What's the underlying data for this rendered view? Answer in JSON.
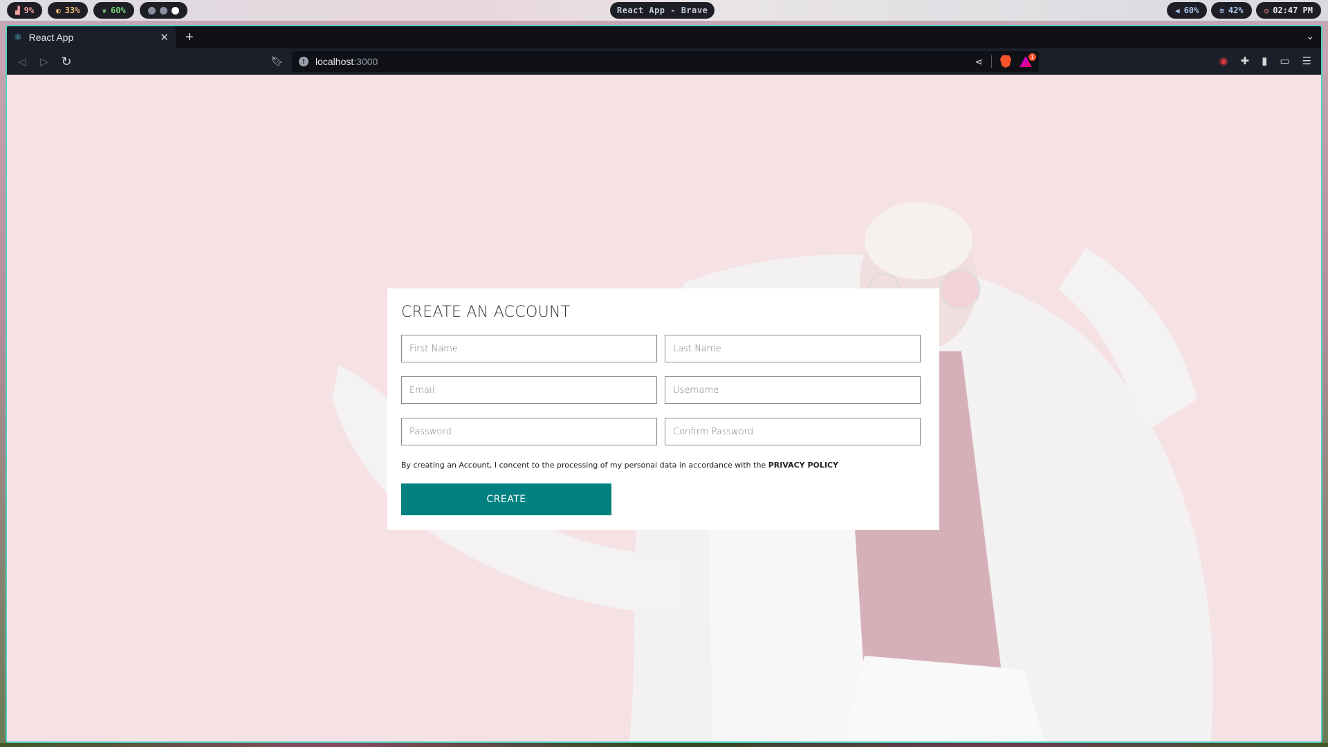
{
  "system_bar": {
    "cpu": "9%",
    "memory": "33%",
    "battery": "60%",
    "window_title": "React App - Brave",
    "volume": "60%",
    "wifi": "42%",
    "clock": "02:47 PM"
  },
  "browser": {
    "tab_title": "React App",
    "url_host": "localhost",
    "url_port": ":3000",
    "rewards_badge": "1"
  },
  "form": {
    "title": "CREATE AN ACCOUNT",
    "first_name_placeholder": "First Name",
    "last_name_placeholder": "Last Name",
    "email_placeholder": "Email",
    "username_placeholder": "Username",
    "password_placeholder": "Password",
    "confirm_password_placeholder": "Confirm Password",
    "agreement_text": "By creating an Account, I concent to the processing of my personal data in accordance with the ",
    "agreement_link": "PRIVACY POLICY",
    "submit_label": "CREATE"
  },
  "colors": {
    "accent": "#008080",
    "page_background": "#f2d3d8",
    "window_border": "#4fd1c5"
  }
}
